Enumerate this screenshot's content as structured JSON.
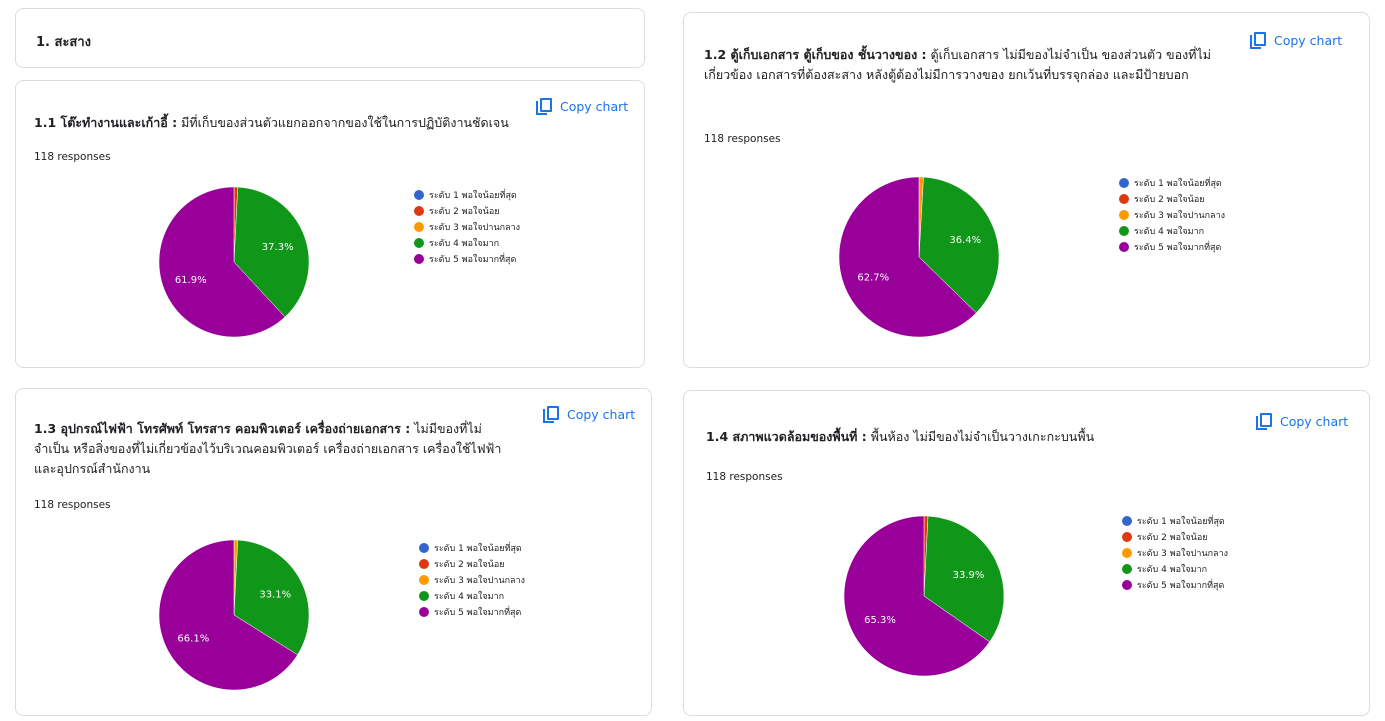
{
  "section": {
    "title": "1. สะสาง"
  },
  "copy_label": "Copy chart",
  "colors": {
    "level1": "#3366cc",
    "level2": "#dc3912",
    "level3": "#ff9900",
    "level4": "#109618",
    "level5": "#990099",
    "link": "#1a73e8"
  },
  "legend_labels": [
    "ระดับ 1 พอใจน้อยที่สุด",
    "ระดับ 2 พอใจน้อย",
    "ระดับ 3 พอใจปานกลาง",
    "ระดับ 4 พอใจมาก",
    "ระดับ 5 พอใจมากที่สุด"
  ],
  "charts": [
    {
      "title_bold": "1.1 โต๊ะทำงานและเก้าอี้ :",
      "title_rest": " มีที่เก็บของส่วนตัวแยกออกจากของใช้ในการปฏิบัติงานชัดเจน",
      "responses": "118 responses"
    },
    {
      "title_bold": "1.2 ตู้เก็บเอกสาร ตู้เก็บของ ชั้นวางของ :",
      "title_rest": " ตู้เก็บเอกสาร ไม่มีของไม่จำเป็น ของส่วนตัว ของที่ไม่เกี่ยวข้อง เอกสารที่ต้องสะสาง หลังตู้ต้องไม่มีการวางของ ยกเว้นที่บรรจุกล่อง และมีป้ายบอก",
      "responses": "118 responses"
    },
    {
      "title_bold": "1.3 อุปกรณ์ไฟฟ้า โทรศัพท์ โทรสาร คอมพิวเตอร์ เครื่องถ่ายเอกสาร :",
      "title_rest": " ไม่มีของที่ไม่จำเป็น หรือสิ่งของที่ไม่เกี่ยวข้องไว้บริเวณคอมพิวเตอร์ เครื่องถ่ายเอกสาร เครื่องใช้ไฟฟ้าและอุปกรณ์สำนักงาน",
      "responses": "118 responses"
    },
    {
      "title_bold": "1.4 สภาพแวดล้อมของพื้นที่ :",
      "title_rest": " พื้นห้อง ไม่มีของไม่จำเป็นวางเกะกะบนพื้น",
      "responses": "118 responses"
    }
  ],
  "chart_data": [
    {
      "type": "pie",
      "categories": [
        "ระดับ 1 พอใจน้อยที่สุด",
        "ระดับ 2 พอใจน้อย",
        "ระดับ 3 พอใจปานกลาง",
        "ระดับ 4 พอใจมาก",
        "ระดับ 5 พอใจมากที่สุด"
      ],
      "values": [
        0,
        0.8,
        0,
        37.3,
        61.9
      ],
      "labels": [
        "",
        "",
        "",
        "37.3%",
        "61.9%"
      ],
      "legend": "right"
    },
    {
      "type": "pie",
      "categories": [
        "ระดับ 1 พอใจน้อยที่สุด",
        "ระดับ 2 พอใจน้อย",
        "ระดับ 3 พอใจปานกลาง",
        "ระดับ 4 พอใจมาก",
        "ระดับ 5 พอใจมากที่สุด"
      ],
      "values": [
        0,
        0,
        0.9,
        36.4,
        62.7
      ],
      "labels": [
        "",
        "",
        "",
        "36.4%",
        "62.7%"
      ],
      "legend": "right"
    },
    {
      "type": "pie",
      "categories": [
        "ระดับ 1 พอใจน้อยที่สุด",
        "ระดับ 2 พอใจน้อย",
        "ระดับ 3 พอใจปานกลาง",
        "ระดับ 4 พอใจมาก",
        "ระดับ 5 พอใจมากที่สุด"
      ],
      "values": [
        0,
        0,
        0.8,
        33.1,
        66.1
      ],
      "labels": [
        "",
        "",
        "",
        "33.1%",
        "66.1%"
      ],
      "legend": "right"
    },
    {
      "type": "pie",
      "categories": [
        "ระดับ 1 พอใจน้อยที่สุด",
        "ระดับ 2 พอใจน้อย",
        "ระดับ 3 พอใจปานกลาง",
        "ระดับ 4 พอใจมาก",
        "ระดับ 5 พอใจมากที่สุด"
      ],
      "values": [
        0,
        0.8,
        0,
        33.9,
        65.3
      ],
      "labels": [
        "",
        "",
        "",
        "33.9%",
        "65.3%"
      ],
      "legend": "right"
    }
  ]
}
